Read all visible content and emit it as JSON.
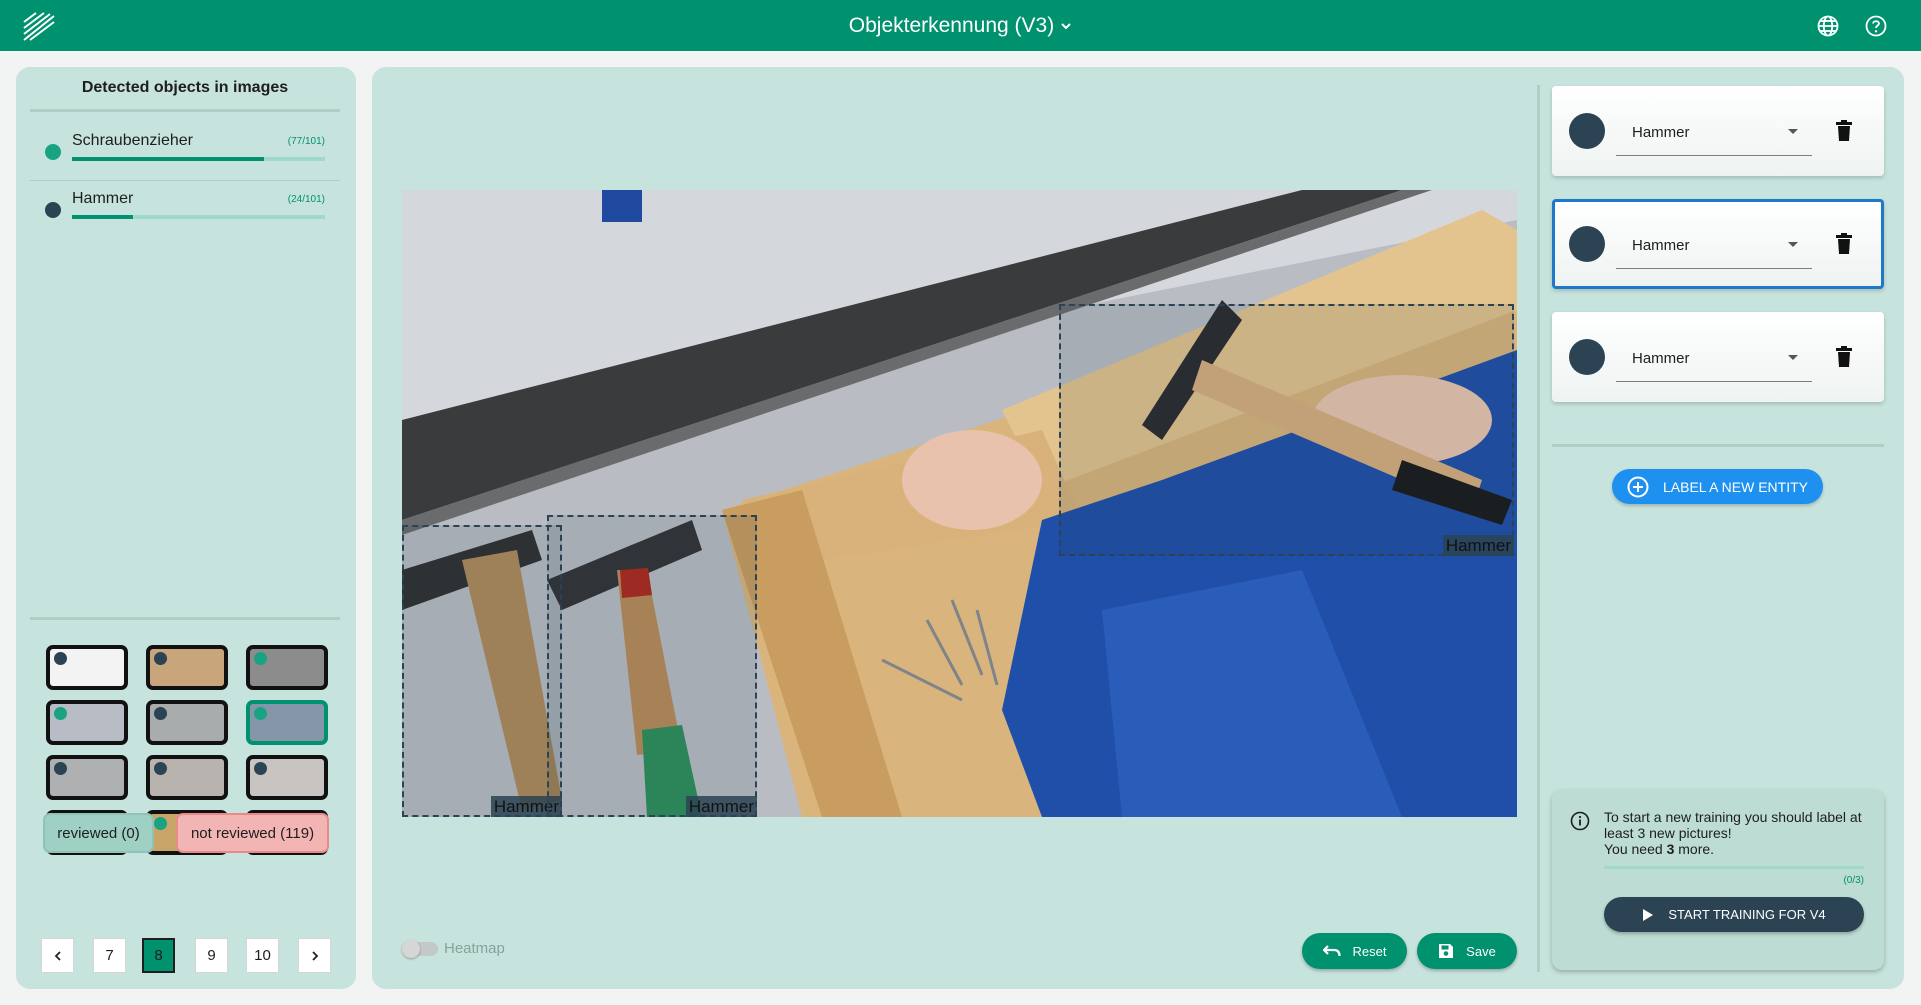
{
  "header": {
    "title": "Objekterkennung (V3)"
  },
  "sidebar": {
    "title": "Detected objects in images",
    "classes": [
      {
        "name": "Schraubenzieher",
        "count": "(77/101)",
        "progress": 0.76,
        "color": "#1aa383"
      },
      {
        "name": "Hammer",
        "count": "(24/101)",
        "progress": 0.24,
        "color": "#2b4352"
      }
    ],
    "thumbnails": [
      {
        "dot": "#2b4352",
        "bg": "#f3f3f3",
        "active": false
      },
      {
        "dot": "#2b4352",
        "bg": "#c8a57a",
        "active": false
      },
      {
        "dot": "#1aa383",
        "bg": "#8c8c8c",
        "active": false
      },
      {
        "dot": "#1aa383",
        "bg": "#b8bcc4",
        "active": false
      },
      {
        "dot": "#2b4352",
        "bg": "#a9acad",
        "active": false
      },
      {
        "dot": "#1aa383",
        "bg": "#8596a8",
        "active": true
      },
      {
        "dot": "#2b4352",
        "bg": "#aeb0b2",
        "active": false
      },
      {
        "dot": "#2b4352",
        "bg": "#b9b3b0",
        "active": false
      },
      {
        "dot": "#2b4352",
        "bg": "#c8c4c2",
        "active": false
      },
      {
        "dot": "#1aa383",
        "bg": "#9a8c6e",
        "active": false
      },
      {
        "dot": "#1aa383",
        "bg": "#c7a468",
        "active": false
      },
      {
        "dot": "#1aa383",
        "bg": "#9aa3b5",
        "active": false
      }
    ],
    "filters": {
      "reviewed": "reviewed (0)",
      "not_reviewed": "not reviewed (119)"
    },
    "pagination": {
      "pages": [
        "7",
        "8",
        "9",
        "10"
      ],
      "current": "8"
    }
  },
  "canvas": {
    "boxes": [
      {
        "label": "Hammer"
      },
      {
        "label": "Hammer"
      },
      {
        "label": "Hammer"
      }
    ],
    "heatmap_label": "Heatmap",
    "reset_label": "Reset",
    "save_label": "Save"
  },
  "entities": [
    {
      "value": "Hammer",
      "selected": false
    },
    {
      "value": "Hammer",
      "selected": true
    },
    {
      "value": "Hammer",
      "selected": false
    }
  ],
  "label_button": "LABEL A NEW ENTITY",
  "training": {
    "line1": "To start a new training you should label at least 3 new pictures!",
    "line2_prefix": "You need",
    "line2_count": "3",
    "line2_suffix": "more.",
    "count": "(0/3)",
    "button": "START TRAINING FOR V4"
  },
  "colors": {
    "accent": "#00916e",
    "panel": "#c7e3dd",
    "blue": "#1e90f0",
    "dark": "#2b4352"
  }
}
